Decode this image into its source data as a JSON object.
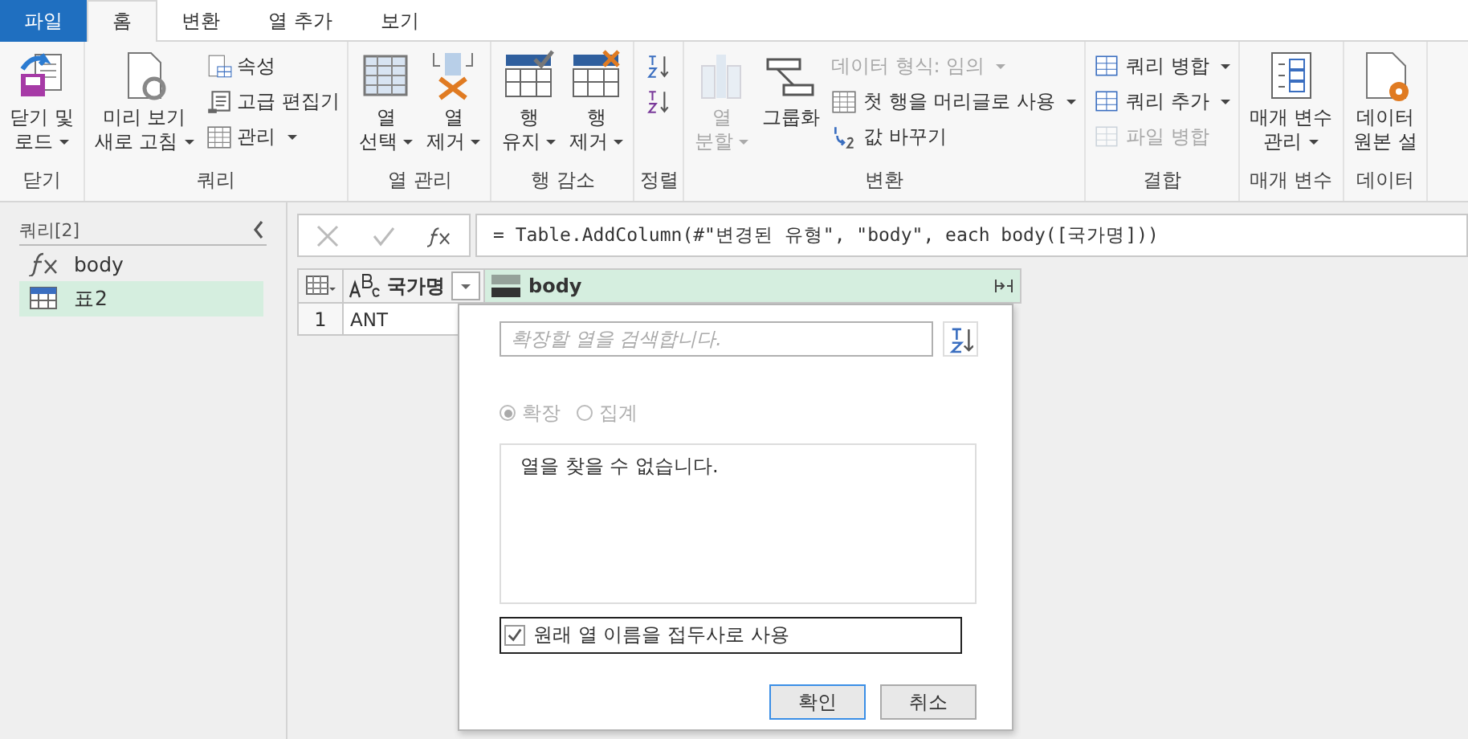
{
  "tabs": [
    {
      "label": "파일",
      "kind": "file",
      "selected": false
    },
    {
      "label": "홈",
      "kind": "tab",
      "selected": true
    },
    {
      "label": "변환",
      "kind": "tab",
      "selected": false
    },
    {
      "label": "열 추가",
      "kind": "tab",
      "selected": false
    },
    {
      "label": "보기",
      "kind": "tab",
      "selected": false
    }
  ],
  "ribbon_groups": [
    {
      "label": "닫기",
      "items": [
        {
          "kind": "big",
          "lines": [
            "닫기 및",
            "로드"
          ],
          "dropdown": true,
          "disabled": false
        }
      ]
    },
    {
      "label": "쿼리",
      "items": [
        {
          "kind": "big",
          "lines": [
            "미리 보기",
            "새로 고침"
          ],
          "dropdown": true,
          "disabled": false
        },
        {
          "kind": "stack",
          "buttons": [
            {
              "label": "속성",
              "dropdown": false,
              "disabled": false
            },
            {
              "label": "고급 편집기",
              "dropdown": false,
              "disabled": false
            },
            {
              "label": "관리",
              "dropdown": true,
              "disabled": false
            }
          ]
        }
      ]
    },
    {
      "label": "열 관리",
      "items": [
        {
          "kind": "big",
          "lines": [
            "열",
            "선택"
          ],
          "dropdown": true,
          "disabled": false
        },
        {
          "kind": "big",
          "lines": [
            "열",
            "제거"
          ],
          "dropdown": true,
          "disabled": false
        }
      ]
    },
    {
      "label": "행 감소",
      "items": [
        {
          "kind": "big",
          "lines": [
            "행",
            "유지"
          ],
          "dropdown": true,
          "disabled": false
        },
        {
          "kind": "big",
          "lines": [
            "행",
            "제거"
          ],
          "dropdown": true,
          "disabled": false
        }
      ]
    },
    {
      "label": "정렬",
      "items": [
        {
          "kind": "stack",
          "buttons": [
            {
              "disabled": false
            },
            {
              "disabled": false
            }
          ]
        }
      ]
    },
    {
      "label": "변환",
      "items": [
        {
          "kind": "big",
          "lines": [
            "열",
            "분할"
          ],
          "dropdown": true,
          "disabled": true
        },
        {
          "kind": "big",
          "lines": [
            "그룹화"
          ],
          "dropdown": false,
          "disabled": false
        },
        {
          "kind": "stack",
          "buttons": [
            {
              "label": "데이터 형식: 임의",
              "dropdown": true,
              "disabled": true
            },
            {
              "label": "첫 행을 머리글로 사용",
              "dropdown": true,
              "disabled": false
            },
            {
              "label": "값 바꾸기",
              "dropdown": false,
              "disabled": false
            }
          ]
        }
      ]
    },
    {
      "label": "결합",
      "items": [
        {
          "kind": "stack",
          "buttons": [
            {
              "label": "쿼리 병합",
              "dropdown": true,
              "disabled": false
            },
            {
              "label": "쿼리 추가",
              "dropdown": true,
              "disabled": false
            },
            {
              "label": "파일 병합",
              "dropdown": false,
              "disabled": true
            }
          ]
        }
      ]
    },
    {
      "label": "매개 변수",
      "items": [
        {
          "kind": "big",
          "lines": [
            "매개 변수",
            "관리"
          ],
          "dropdown": true,
          "disabled": false
        }
      ]
    },
    {
      "label": "데이터",
      "items": [
        {
          "kind": "big",
          "lines": [
            "데이터",
            "원본 설"
          ],
          "dropdown": false,
          "disabled": false
        }
      ]
    }
  ],
  "queries": {
    "title": "쿼리[2]",
    "items": [
      {
        "name": "body",
        "kind": "function",
        "selected": false
      },
      {
        "name": "표2",
        "kind": "table",
        "selected": true
      }
    ]
  },
  "formula_bar": {
    "formula": "= Table.AddColumn(#\"변경된 유형\", \"body\", each body([국가명]))"
  },
  "table": {
    "columns": [
      {
        "name": "국가명",
        "kind": "text",
        "selected": false
      },
      {
        "name": "body",
        "kind": "any",
        "selected": true
      }
    ],
    "rows": [
      {
        "index": "1",
        "cells": [
          "ANT"
        ]
      }
    ]
  },
  "expand_popup": {
    "search": {
      "placeholder": "확장할 열을 검색합니다."
    },
    "options": [
      {
        "label": "확장",
        "selected": true,
        "disabled": true
      },
      {
        "label": "집계",
        "selected": false,
        "disabled": true
      }
    ],
    "message": "열을 찾을 수 없습니다.",
    "prefix_checkbox": {
      "label": "원래 열 이름을 접두사로 사용",
      "checked": true
    },
    "buttons": [
      {
        "label": "확인",
        "kind": "primary"
      },
      {
        "label": "취소",
        "kind": "secondary"
      }
    ]
  }
}
